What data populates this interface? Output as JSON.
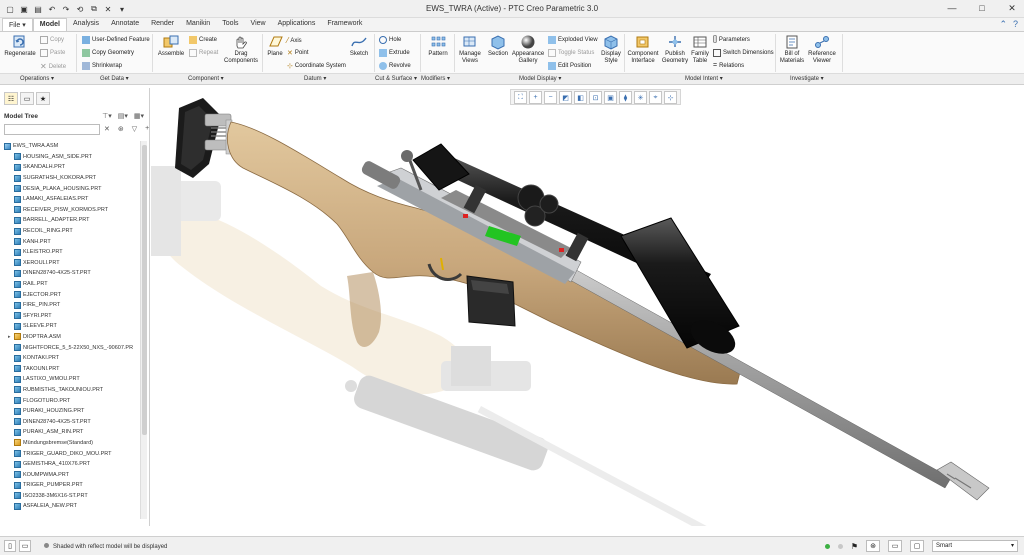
{
  "window": {
    "title": "EWS_TWRA (Active) - PTC Creo Parametric 3.0"
  },
  "tabs": [
    {
      "label": "File ▾"
    },
    {
      "label": "Model"
    },
    {
      "label": "Analysis"
    },
    {
      "label": "Annotate"
    },
    {
      "label": "Render"
    },
    {
      "label": "Manikin"
    },
    {
      "label": "Tools"
    },
    {
      "label": "View"
    },
    {
      "label": "Applications"
    },
    {
      "label": "Framework"
    }
  ],
  "ribbon": {
    "regenerate": "Regenerate",
    "copy": "Copy",
    "paste": "Paste",
    "delete": "Delete",
    "udf": "User-Defined Feature",
    "copy_geometry": "Copy Geometry",
    "shrinkwrap": "Shrinkwrap",
    "assemble": "Assemble",
    "create": "Create",
    "repeat": "Repeat",
    "drag_components": "Drag Components",
    "plane": "Plane",
    "axis": "Axis",
    "point": "Point",
    "coordinate_system": "Coordinate System",
    "sketch": "Sketch",
    "hole": "Hole",
    "extrude": "Extrude",
    "revolve": "Revolve",
    "pattern": "Pattern",
    "manage_views": "Manage Views",
    "section": "Section",
    "appearance_gallery": "Appearance Gallery",
    "exploded_view": "Exploded View",
    "toggle_status": "Toggle Status",
    "edit_position": "Edit Position",
    "display_style": "Display Style",
    "component_interface": "Component Interface",
    "publish_geometry": "Publish Geometry",
    "family_table": "Family Table",
    "parameters": "Parameters",
    "switch_dimensions": "Switch Dimensions",
    "relations": "Relations",
    "bill_of_materials": "Bill of Materials",
    "reference_viewer": "Reference Viewer"
  },
  "groups": [
    {
      "label": "Operations ▾"
    },
    {
      "label": "Get Data ▾"
    },
    {
      "label": "Component ▾"
    },
    {
      "label": "Datum ▾"
    },
    {
      "label": "Cut & Surface ▾"
    },
    {
      "label": "Modifiers ▾"
    },
    {
      "label": "Model Display ▾"
    },
    {
      "label": "Model Intent ▾"
    },
    {
      "label": "Investigate ▾"
    }
  ],
  "model_tree": {
    "title": "Model Tree",
    "root": "EWS_TWRA.ASM",
    "items": [
      {
        "label": "HOUSING_ASM_SIDE.PRT",
        "type": "part"
      },
      {
        "label": "SKANDALH.PRT",
        "type": "part"
      },
      {
        "label": "SUGRATHSH_KOKORA.PRT",
        "type": "part"
      },
      {
        "label": "DESIA_PLAKA_HOUSING.PRT",
        "type": "part"
      },
      {
        "label": "LAMAKI_ASFALEIAS.PRT",
        "type": "part"
      },
      {
        "label": "RECEIVER_PISW_KORMOS.PRT",
        "type": "part"
      },
      {
        "label": "BARRELL_ADAPTER.PRT",
        "type": "part"
      },
      {
        "label": "RECOIL_RING.PRT",
        "type": "part"
      },
      {
        "label": "KANH.PRT",
        "type": "part"
      },
      {
        "label": "KLEISTRO.PRT",
        "type": "part"
      },
      {
        "label": "XEROULI.PRT",
        "type": "part"
      },
      {
        "label": "DINEN28740-4X25-ST.PRT",
        "type": "part"
      },
      {
        "label": "RAIL.PRT",
        "type": "part"
      },
      {
        "label": "EJECTOR.PRT",
        "type": "part"
      },
      {
        "label": "FIRE_PIN.PRT",
        "type": "part"
      },
      {
        "label": "SFYRI.PRT",
        "type": "part"
      },
      {
        "label": "SLEEVE.PRT",
        "type": "part"
      },
      {
        "label": "DIOPTRA.ASM",
        "type": "asm",
        "expandable": true
      },
      {
        "label": "NIGHTFORCE_5_5-22X50_NXS_-90607.PR",
        "type": "part"
      },
      {
        "label": "KONTAKI.PRT",
        "type": "part"
      },
      {
        "label": "TAKOUNI.PRT",
        "type": "part"
      },
      {
        "label": "LASTIXO_WMOU.PRT",
        "type": "part"
      },
      {
        "label": "RUBMISTHS_TAKOUNIOU.PRT",
        "type": "part"
      },
      {
        "label": "FLOGOTURO.PRT",
        "type": "part"
      },
      {
        "label": "PURAKI_HOUZING.PRT",
        "type": "part"
      },
      {
        "label": "DINEN28740-4X25-ST.PRT",
        "type": "part"
      },
      {
        "label": "PURAKI_ASM_RIN.PRT",
        "type": "part"
      },
      {
        "label": "Mündungsbremse(Standard)",
        "type": "asm"
      },
      {
        "label": "TRIGER_GUARD_DIKO_MOU.PRT",
        "type": "part"
      },
      {
        "label": "GEMISTHRA_410X76.PRT",
        "type": "part"
      },
      {
        "label": "KOUMPWMA.PRT",
        "type": "part"
      },
      {
        "label": "TRIGER_PUMPER.PRT",
        "type": "part"
      },
      {
        "label": "ISO2338-3M6X16-ST.PRT",
        "type": "part"
      },
      {
        "label": "ASFALEIA_NEW.PRT",
        "type": "part"
      }
    ]
  },
  "statusbar": {
    "message": "Shaded with reflect model will be displayed",
    "filter_value": "Smart"
  },
  "colors": {
    "stock": "#c8a77c",
    "scope": "#151515",
    "barrel": "#b8b8b8",
    "accent": "#3a6fb0",
    "green_part": "#22c422"
  }
}
